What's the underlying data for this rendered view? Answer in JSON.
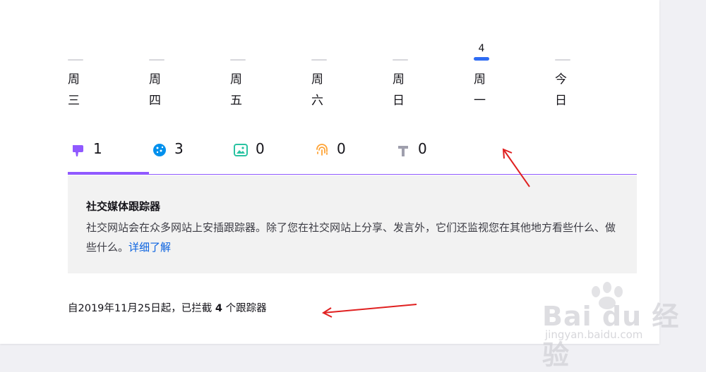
{
  "weekday_chart": {
    "days": [
      {
        "label": "周三",
        "count": null
      },
      {
        "label": "周四",
        "count": null
      },
      {
        "label": "周五",
        "count": null
      },
      {
        "label": "周六",
        "count": null
      },
      {
        "label": "周日",
        "count": null
      },
      {
        "label": "周一",
        "count": "4"
      },
      {
        "label": "今日",
        "count": null
      }
    ],
    "active_index": 5,
    "active_color": "#2f6cf3"
  },
  "tracker_tabs": [
    {
      "icon": "social-thumbs-down-icon",
      "count": "1",
      "color": "#9059ff",
      "selected": true
    },
    {
      "icon": "cookie-icon",
      "count": "3",
      "color": "#0090ed",
      "selected": false
    },
    {
      "icon": "image-icon",
      "count": "0",
      "color": "#2ac3a2",
      "selected": false
    },
    {
      "icon": "fingerprint-icon",
      "count": "0",
      "color": "#ffa436",
      "selected": false
    },
    {
      "icon": "hammer-icon",
      "count": "0",
      "color": "#9f9fad",
      "selected": false
    }
  ],
  "panel": {
    "title": "社交媒体跟踪器",
    "description": "社交网站会在众多网站上安插跟踪器。除了您在社交网站上分享、发言外，它们还监视您在其他地方看些什么、做些什么。",
    "learn_more": "详细了解"
  },
  "summary": {
    "prefix": "自2019年11月25日起，已拦截 ",
    "count": "4",
    "suffix": " 个跟踪器"
  },
  "watermark": {
    "brand": "Bai du 经验",
    "url": "jingyan.baidu.com"
  },
  "annotation_color": "#e02020"
}
